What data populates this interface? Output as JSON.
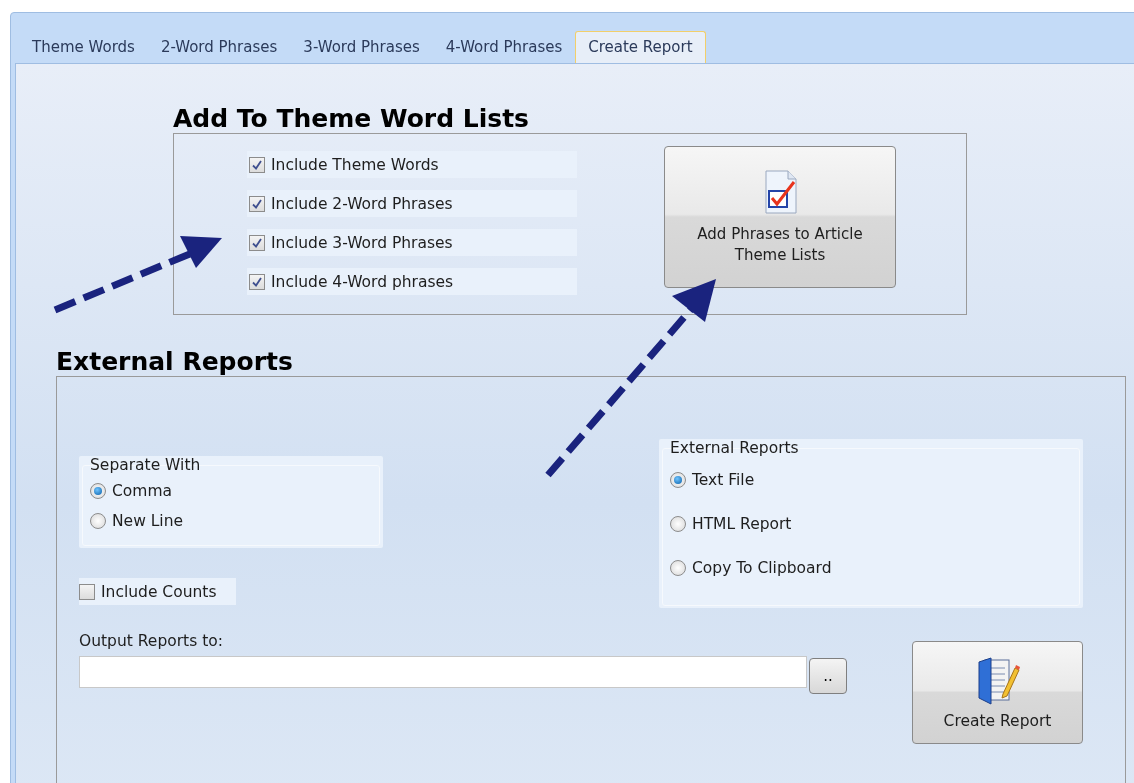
{
  "tabs": [
    {
      "label": "Theme Words",
      "selected": false
    },
    {
      "label": "2-Word Phrases",
      "selected": false
    },
    {
      "label": "3-Word Phrases",
      "selected": false
    },
    {
      "label": "4-Word Phrases",
      "selected": false
    },
    {
      "label": "Create Report",
      "selected": true
    }
  ],
  "theme_lists": {
    "title": "Add To Theme Word Lists",
    "options": [
      {
        "label": "Include Theme Words",
        "checked": true
      },
      {
        "label": "Include 2-Word Phrases",
        "checked": true
      },
      {
        "label": "Include 3-Word Phrases",
        "checked": true
      },
      {
        "label": "Include 4-Word phrases",
        "checked": true
      }
    ],
    "button": "Add Phrases to Article Theme Lists"
  },
  "external": {
    "title": "External Reports",
    "separate_with": {
      "legend": "Separate With",
      "options": [
        {
          "label": "Comma",
          "selected": true
        },
        {
          "label": "New Line",
          "selected": false
        }
      ]
    },
    "include_counts": {
      "label": "Include Counts",
      "checked": false
    },
    "output_label": "Output Reports to:",
    "browse_button": "..",
    "report_type": {
      "legend": "External Reports",
      "options": [
        {
          "label": "Text File",
          "selected": true
        },
        {
          "label": "HTML Report",
          "selected": false
        },
        {
          "label": "Copy To Clipboard",
          "selected": false
        }
      ]
    },
    "create_button": "Create Report"
  }
}
